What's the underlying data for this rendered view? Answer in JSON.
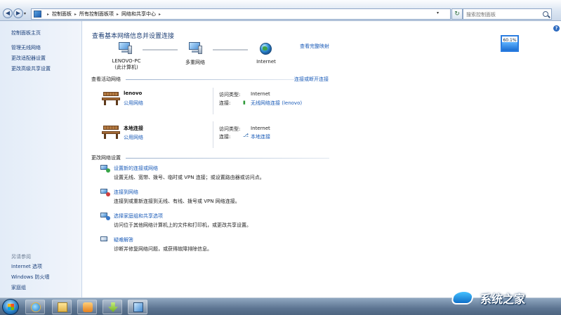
{
  "window": {
    "breadcrumbs": [
      "控制面板",
      "所有控制面板项",
      "网络和共享中心"
    ],
    "search_placeholder": "搜索控制面板"
  },
  "sidebar": {
    "top_links": [
      "控制面板主页",
      "管理无线网络",
      "更改适配器设置",
      "更改高级共享设置"
    ],
    "see_also_label": "另请参阅",
    "bottom_links": [
      "Internet 选项",
      "Windows 防火墙",
      "家庭组"
    ]
  },
  "main": {
    "title": "查看基本网络信息并设置连接",
    "full_map_link": "查看完整映射",
    "map": {
      "computer": {
        "name": "LENOVO-PC",
        "sub": "(此计算机)"
      },
      "network": {
        "name": "多重网络"
      },
      "internet": {
        "name": "Internet"
      }
    },
    "active_section": {
      "title": "查看活动网络",
      "action_link": "连接或断开连接",
      "networks": [
        {
          "name": "lenovo",
          "type": "公用网络",
          "access_label": "访问类型:",
          "access_value": "Internet",
          "conn_label": "连接:",
          "conn_value": "无线网络连接 (lenovo)"
        },
        {
          "name": "本地连接",
          "type": "公用网络",
          "access_label": "访问类型:",
          "access_value": "Internet",
          "conn_label": "连接:",
          "conn_value": "本地连接"
        }
      ]
    },
    "change_section": {
      "title": "更改网络设置",
      "tasks": [
        {
          "title": "设置新的连接或网络",
          "desc": "设置无线、宽带、拨号、临时或 VPN 连接；或设置路由器或访问点。"
        },
        {
          "title": "连接到网络",
          "desc": "连接到或重新连接到无线、有线、拨号或 VPN 网络连接。"
        },
        {
          "title": "选择家庭组和共享选项",
          "desc": "访问位于其他网络计算机上的文件和打印机，或更改共享设置。"
        },
        {
          "title": "疑难解答",
          "desc": "诊断并修复网络问题，或获得故障排除信息。"
        }
      ]
    }
  },
  "widget": {
    "value_text": "60.1%",
    "level_percent": 60.1
  },
  "watermark": {
    "text": "系统之家"
  },
  "colors": {
    "link": "#1a5bb8",
    "heading": "#1e3f74",
    "taskbar": "#5d7592"
  }
}
